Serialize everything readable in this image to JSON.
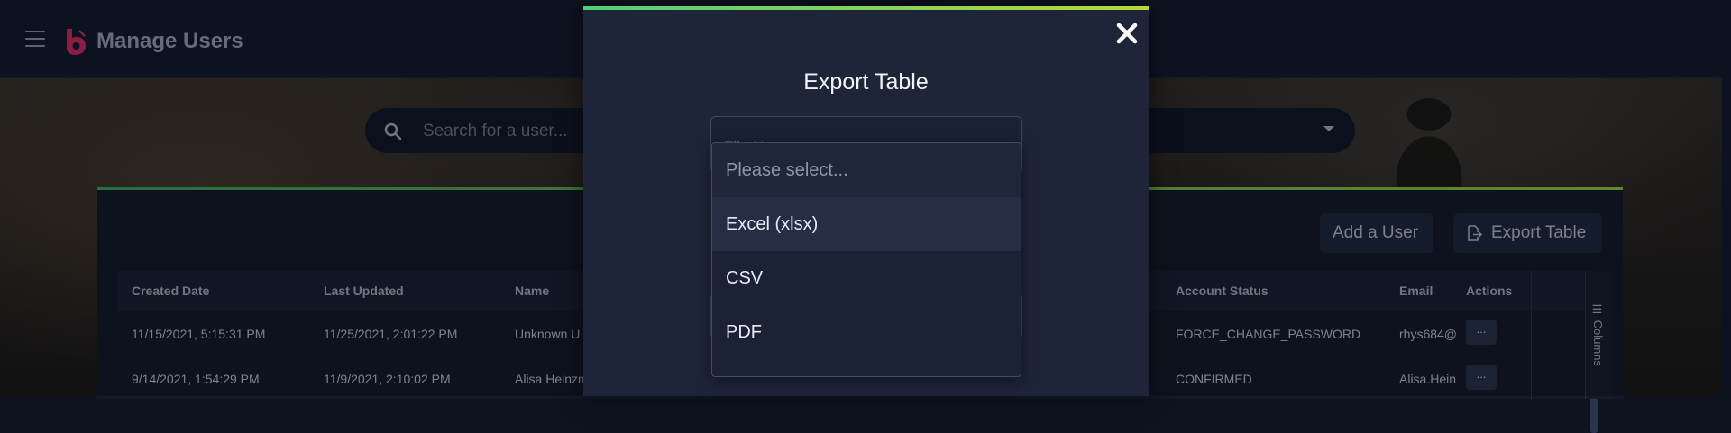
{
  "header": {
    "title": "Manage Users"
  },
  "search": {
    "placeholder": "Search for a user..."
  },
  "toolbar": {
    "add_label": "Add a User",
    "export_label": "Export Table"
  },
  "table": {
    "columns": [
      "Created Date",
      "Last Updated",
      "Name",
      "Account Status",
      "Email",
      "Actions"
    ],
    "rows": [
      {
        "created": "11/15/2021, 5:15:31 PM",
        "updated": "11/25/2021, 2:01:22 PM",
        "name": "Unknown U",
        "status": "FORCE_CHANGE_PASSWORD",
        "email": "rhys684@",
        "action": "..."
      },
      {
        "created": "9/14/2021, 1:54:29 PM",
        "updated": "11/9/2021, 2:10:02 PM",
        "name": "Alisa Heinzm",
        "status": "CONFIRMED",
        "email": "Alisa.Hein",
        "action": "..."
      }
    ],
    "columns_toggle": "Columns"
  },
  "modal": {
    "title": "Export Table",
    "field_label": "File Name",
    "dropdown": {
      "placeholder": "Please select...",
      "options": [
        "Excel (xlsx)",
        "CSV",
        "PDF"
      ]
    }
  },
  "colors": {
    "accent_green": "#3ea35a",
    "accent_lime": "#b6d83a",
    "logo_pink": "#e0306a"
  }
}
